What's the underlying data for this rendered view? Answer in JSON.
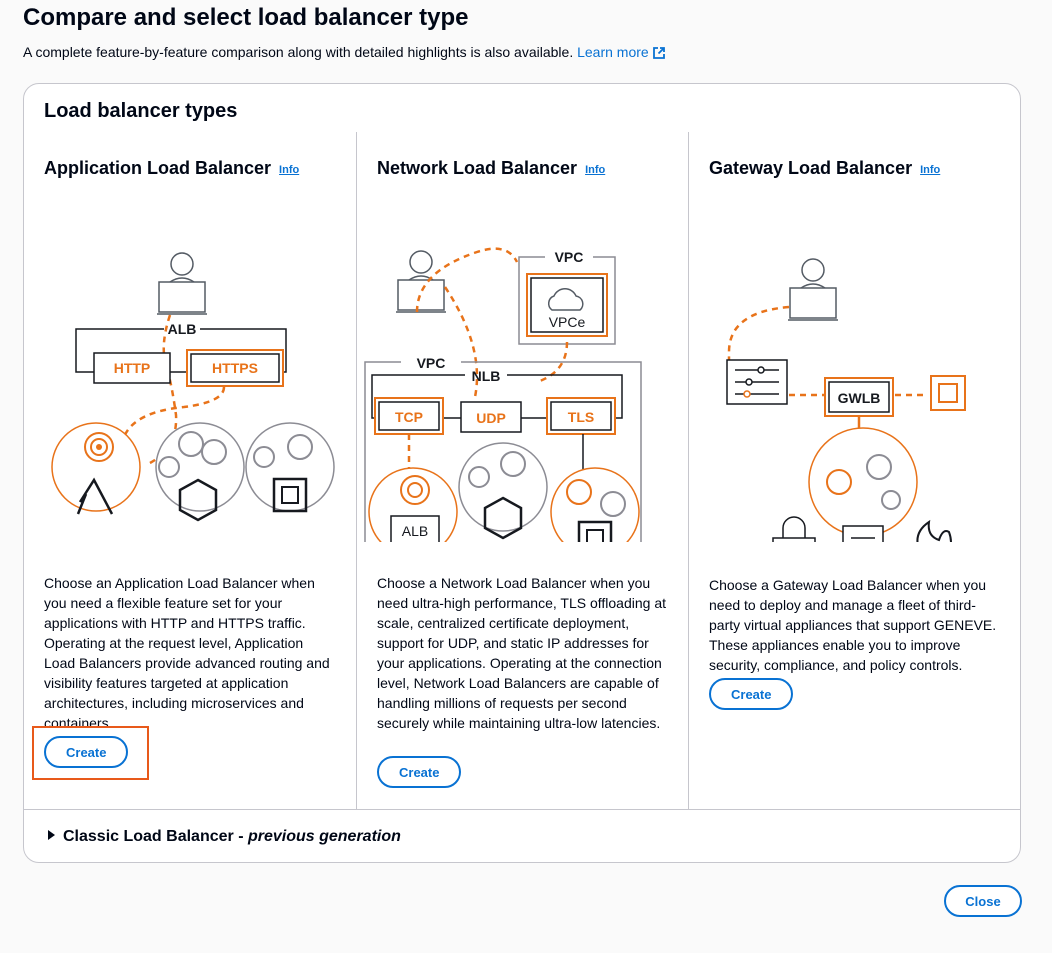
{
  "page": {
    "title": "Compare and select load balancer type",
    "subtitle": "A complete feature-by-feature comparison along with detailed highlights is also available.",
    "learn_more": "Learn more"
  },
  "container": {
    "title": "Load balancer types"
  },
  "alb": {
    "title": "Application Load Balancer",
    "info": "Info",
    "description": "Choose an Application Load Balancer when you need a flexible feature set for your applications with HTTP and HTTPS traffic. Operating at the request level, Application Load Balancers provide advanced routing and visibility features targeted at application architectures, including microservices and containers.",
    "create": "Create",
    "diagram": {
      "group": "ALB",
      "listener1": "HTTP",
      "listener2": "HTTPS"
    }
  },
  "nlb": {
    "title": "Network Load Balancer",
    "info": "Info",
    "description": "Choose a Network Load Balancer when you need ultra-high performance, TLS offloading at scale, centralized certificate deployment, support for UDP, and static IP addresses for your applications. Operating at the connection level, Network Load Balancers are capable of handling millions of requests per second securely while maintaining ultra-low latencies.",
    "create": "Create",
    "diagram": {
      "vpc_top": "VPC",
      "vpce": "VPCe",
      "vpc": "VPC",
      "nlb": "NLB",
      "tcp": "TCP",
      "udp": "UDP",
      "tls": "TLS",
      "alb": "ALB"
    }
  },
  "gwlb": {
    "title": "Gateway Load Balancer",
    "info": "Info",
    "description": "Choose a Gateway Load Balancer when you need to deploy and manage a fleet of third-party virtual appliances that support GENEVE. These appliances enable you to improve security, compliance, and policy controls.",
    "create": "Create",
    "diagram": {
      "gwlb": "GWLB"
    }
  },
  "classic": {
    "label": "Classic Load Balancer -",
    "suffix": "previous generation"
  },
  "footer": {
    "close": "Close"
  },
  "colors": {
    "accent": "#0972d3",
    "orange": "#e8731a",
    "highlight": "#e8591a",
    "gray": "#8c8c94"
  }
}
